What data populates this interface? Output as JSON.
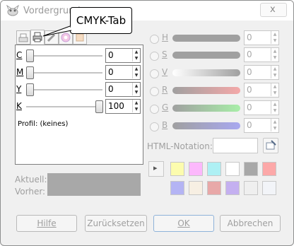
{
  "window": {
    "title": "Vordergrund",
    "close_symbol": "x"
  },
  "callout": {
    "text": "CMYK-Tab"
  },
  "cmyk": {
    "rows": [
      {
        "key": "C",
        "value": "0",
        "level": 0
      },
      {
        "key": "M",
        "value": "0",
        "level": 0
      },
      {
        "key": "Y",
        "value": "0",
        "level": 0
      },
      {
        "key": "K",
        "value": "100",
        "level": 1
      }
    ],
    "profile": "Profil: (keines)"
  },
  "rgb_hsv": {
    "rows": [
      {
        "key": "H",
        "value": "0",
        "colors": [
          "#a0a0a0",
          "#a0a0a0"
        ]
      },
      {
        "key": "S",
        "value": "0",
        "colors": [
          "#a0a0a0",
          "#a0a0a0"
        ]
      },
      {
        "key": "V",
        "value": "0",
        "colors": [
          "#ffffff",
          "#a0a0a0"
        ]
      },
      {
        "key": "R",
        "value": "0",
        "colors": [
          "#a0a0a0",
          "#f4a8a8"
        ]
      },
      {
        "key": "G",
        "value": "0",
        "colors": [
          "#a0a0a0",
          "#a8eea8"
        ]
      },
      {
        "key": "B",
        "value": "0",
        "colors": [
          "#a0a0a0",
          "#a8a8f0"
        ]
      }
    ],
    "html_notation_label": "HTML-Notation:",
    "html_notation_value": ""
  },
  "history": {
    "arrow": "▸",
    "swatches_row1": [
      "#fcfcae",
      "#fcb8fc",
      "#aef0f4",
      "#ffffff",
      "#a8a8a8",
      "#fca8a8"
    ],
    "swatches_row2": [
      "#b4b4f4",
      "#f7efe3",
      "#e8a8a8",
      "#c4b0f0",
      "#efefef",
      "#f2f4f8"
    ]
  },
  "preview": {
    "current_label": "Aktuell:",
    "previous_label": "Vorher:",
    "color": "#a8a8a8"
  },
  "buttons": {
    "help": "Hilfe",
    "reset": "Zurücksetzen",
    "ok": "OK",
    "cancel": "Abbrechen"
  }
}
